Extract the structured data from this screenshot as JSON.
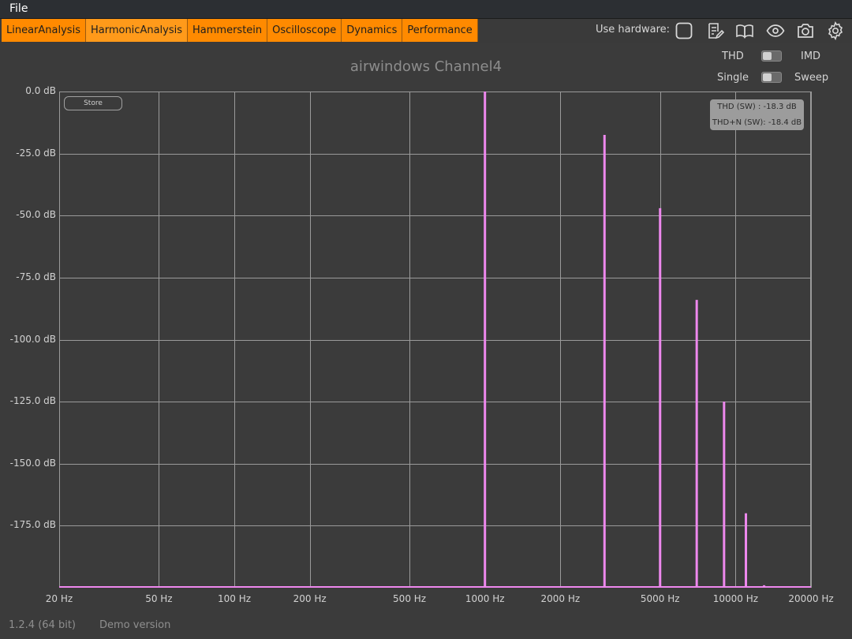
{
  "menubar": {
    "file_label": "File"
  },
  "tabs": [
    {
      "label": "LinearAnalysis"
    },
    {
      "label": "HarmonicAnalysis",
      "active": true
    },
    {
      "label": "Hammerstein"
    },
    {
      "label": "Oscilloscope"
    },
    {
      "label": "Dynamics"
    },
    {
      "label": "Performance"
    }
  ],
  "toolbar": {
    "hardware_label": "Use hardware:",
    "icons": [
      "hardware-checkbox-icon",
      "notes-edit-icon",
      "manual-book-icon",
      "eye-icon",
      "camera-icon",
      "gear-icon"
    ]
  },
  "options": {
    "thd_label": "THD",
    "imd_label": "IMD",
    "single_label": "Single",
    "sweep_label": "Sweep"
  },
  "store_label": "Store",
  "thd_box": {
    "thd": "THD (SW) : -18.3 dB",
    "thdn": "THD+N (SW): -18.4 dB"
  },
  "footer": {
    "version": "1.2.4 (64 bit)",
    "demo": "Demo version"
  },
  "colors": {
    "accent": "#ff8a00",
    "series": "#ee88ee",
    "background": "#3b3b3b",
    "grid": "#9a9a9a"
  },
  "chart_data": {
    "type": "bar",
    "title": "airwindows Channel4",
    "xscale": "log",
    "xlim": [
      20,
      20000
    ],
    "ylim": [
      -200,
      0
    ],
    "grid": true,
    "xticks": [
      {
        "label": "20 Hz",
        "value": 20
      },
      {
        "label": "50 Hz",
        "value": 50
      },
      {
        "label": "100 Hz",
        "value": 100
      },
      {
        "label": "200 Hz",
        "value": 200
      },
      {
        "label": "500 Hz",
        "value": 500
      },
      {
        "label": "1000 Hz",
        "value": 1000
      },
      {
        "label": "2000 Hz",
        "value": 2000
      },
      {
        "label": "5000 Hz",
        "value": 5000
      },
      {
        "label": "10000 Hz",
        "value": 10000
      },
      {
        "label": "20000 Hz",
        "value": 20000
      }
    ],
    "yticks": [
      {
        "label": "0.0 dB",
        "value": 0
      },
      {
        "label": "-25.0 dB",
        "value": -25
      },
      {
        "label": "-50.0 dB",
        "value": -50
      },
      {
        "label": "-75.0 dB",
        "value": -75
      },
      {
        "label": "-100.0 dB",
        "value": -100
      },
      {
        "label": "-125.0 dB",
        "value": -125
      },
      {
        "label": "-150.0 dB",
        "value": -150
      },
      {
        "label": "-175.0 dB",
        "value": -175
      }
    ],
    "points": [
      {
        "x": 1000,
        "y": 0
      },
      {
        "x": 3000,
        "y": -17.5
      },
      {
        "x": 5000,
        "y": -47
      },
      {
        "x": 7000,
        "y": -84
      },
      {
        "x": 9000,
        "y": -125
      },
      {
        "x": 11000,
        "y": -170
      },
      {
        "x": 13000,
        "y": -199
      }
    ]
  }
}
